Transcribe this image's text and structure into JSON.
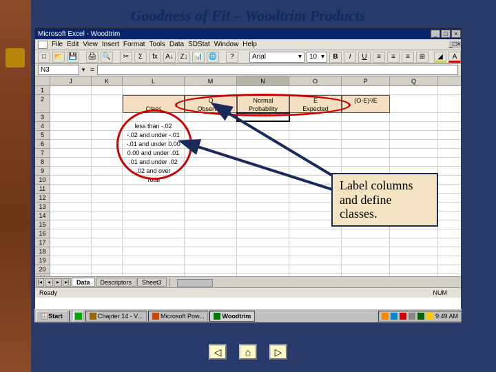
{
  "slide": {
    "title": "Goodness of Fit – Woodtrim Products"
  },
  "window": {
    "app_title": "Microsoft Excel - Woodtrim",
    "menus": [
      "File",
      "Edit",
      "View",
      "Insert",
      "Format",
      "Tools",
      "Data",
      "SDStat",
      "Window",
      "Help"
    ],
    "font_name": "Arial",
    "font_size": "10",
    "name_box": "N3",
    "fx": "="
  },
  "columns": {
    "labels": [
      "J",
      "K",
      "L",
      "M",
      "N",
      "O",
      "P",
      "Q"
    ],
    "active": "N",
    "widths": [
      60,
      45,
      90,
      76,
      76,
      76,
      70,
      70
    ]
  },
  "header_row": {
    "L": "Class",
    "M": "O\nObserved\nFrequency",
    "N": "Normal\nProbability\nDistribution",
    "O": "E\nExpected\nFrequency",
    "P": "(O-E)²/E"
  },
  "class_rows": [
    "less than -.02",
    "-.02 and under -.01",
    "-.01 and under 0.00",
    "0.00 and under .01",
    ".01 and under .02",
    ".02 and over",
    "Total"
  ],
  "row_start": 1,
  "row_header_first_data": 4,
  "sheets": {
    "tabs": [
      "Data",
      "Descriptors",
      "Sheet3"
    ],
    "active": "Data"
  },
  "status": {
    "left": "Ready",
    "num": "NUM"
  },
  "taskbar": {
    "start": "Start",
    "items": [
      {
        "label": "Chapter 14 - V..."
      },
      {
        "label": "Microsoft Pow..."
      },
      {
        "label": "Woodtrim",
        "active": true
      }
    ],
    "clock": "9:49 AM"
  },
  "callout": {
    "text": "Label columns and define classes."
  },
  "nav": {
    "prev": "◁",
    "home": "⌂",
    "next": "▷"
  }
}
